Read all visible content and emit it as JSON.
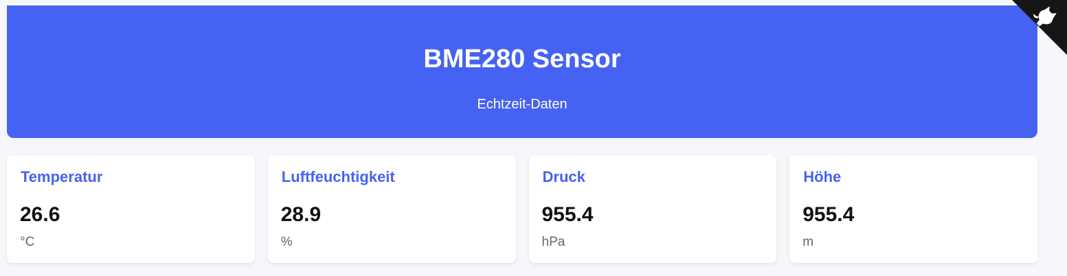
{
  "header": {
    "title": "BME280 Sensor",
    "subtitle": "Echtzeit-Daten"
  },
  "cards": [
    {
      "title": "Temperatur",
      "value": "26.6",
      "unit": "°C"
    },
    {
      "title": "Luftfeuchtigkeit",
      "value": "28.9",
      "unit": "%"
    },
    {
      "title": "Druck",
      "value": "955.4",
      "unit": "hPa"
    },
    {
      "title": "Höhe",
      "value": "955.4",
      "unit": "m"
    }
  ],
  "corner": {
    "icon": "github-octocat-icon"
  },
  "colors": {
    "accent": "#4662f2",
    "background": "#f5f7fb",
    "card": "#ffffff",
    "corner": "#151515"
  }
}
